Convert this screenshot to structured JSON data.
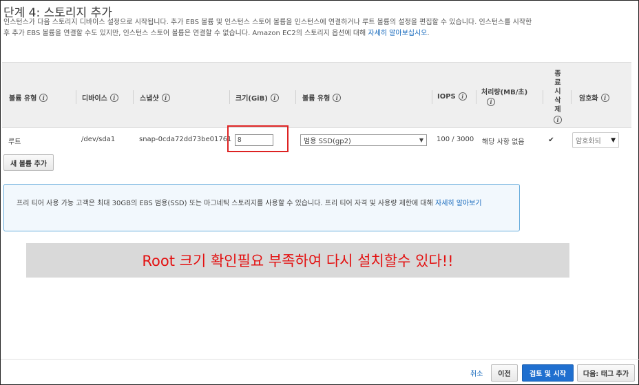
{
  "header": {
    "title": "단계 4: 스토리지 추가",
    "description": "인스턴스가 다음 스토리지 디바이스 설정으로 시작됩니다. 추가 EBS 볼륨 및 인스턴스 스토어 볼륨을 인스턴스에 연결하거나 루트 볼륨의 설정을 편집할 수 있습니다. 인스턴스를 시작한 후 추가 EBS 볼륨을 연결할 수도 있지만, 인스턴스 스토어 볼륨은 연결할 수 없습니다. Amazon EC2의 스토리지 옵션에 대해 ",
    "learn_more": "자세히 알아보십시오",
    "period": "."
  },
  "table": {
    "headers": {
      "volume_type": "볼륨 유형",
      "device": "디바이스",
      "snapshot": "스냅샷",
      "size": "크기(GiB)",
      "volume_type2": "볼륨 유형",
      "iops": "IOPS",
      "throughput": "처리량(MB/초)",
      "delete_chars": [
        "종",
        "료",
        "시",
        "삭",
        "제"
      ],
      "encryption": "암호화"
    },
    "row": {
      "volume_type": "루트",
      "device": "/dev/sda1",
      "snapshot": "snap-0cda72dd73be01761",
      "size": "8",
      "volume_type_select": "범용 SSD(gp2)",
      "iops": "100 / 3000",
      "throughput": "해당 사항 없음",
      "delete_on_termination": "✔",
      "encryption": "암호화되"
    },
    "add_volume": "새 볼륨 추가"
  },
  "info_box": {
    "text": "프리 티어 사용 가능 고객은 최대 30GB의 EBS 범용(SSD) 또는 마그네틱 스토리지를 사용할 수 있습니다. 프리 티어 자격 및 사용량 제한에 대해 ",
    "link": "자세히 알아보기"
  },
  "banner": {
    "text": "Root 크기 확인필요 부족하여 다시 설치할수 있다!!"
  },
  "footer": {
    "cancel": "취소",
    "previous": "이전",
    "review_launch": "검토 및 시작",
    "next": "다음: 태그 추가"
  },
  "colors": {
    "primary": "#1f6fcf",
    "link": "#1166bb",
    "highlight": "#dd2222",
    "banner_text": "#e31010"
  }
}
